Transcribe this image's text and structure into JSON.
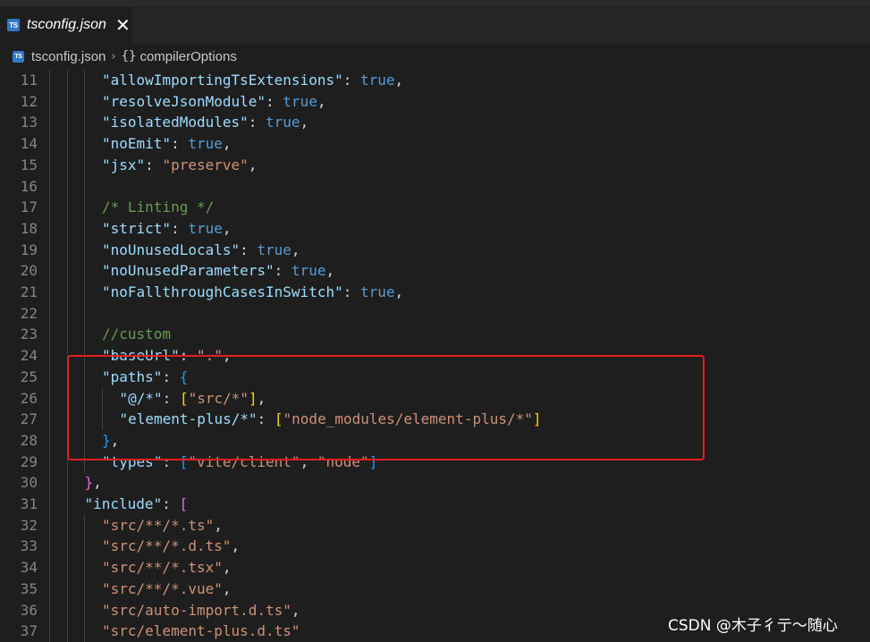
{
  "tab": {
    "icon": "TS",
    "title": "tsconfig.json",
    "close": "✕"
  },
  "breadcrumb": {
    "file": "tsconfig.json",
    "separator": "›",
    "symbol_icon": "{}",
    "symbol": "compilerOptions"
  },
  "lines": [
    {
      "n": "11",
      "indent": 8,
      "tokens": [
        [
          "k",
          "\"allowImportingTsExtensions\""
        ],
        [
          "p",
          ": "
        ],
        [
          "t",
          "true"
        ],
        [
          "p",
          ","
        ]
      ]
    },
    {
      "n": "12",
      "indent": 8,
      "tokens": [
        [
          "k",
          "\"resolveJsonModule\""
        ],
        [
          "p",
          ": "
        ],
        [
          "t",
          "true"
        ],
        [
          "p",
          ","
        ]
      ]
    },
    {
      "n": "13",
      "indent": 8,
      "tokens": [
        [
          "k",
          "\"isolatedModules\""
        ],
        [
          "p",
          ": "
        ],
        [
          "t",
          "true"
        ],
        [
          "p",
          ","
        ]
      ]
    },
    {
      "n": "14",
      "indent": 8,
      "tokens": [
        [
          "k",
          "\"noEmit\""
        ],
        [
          "p",
          ": "
        ],
        [
          "t",
          "true"
        ],
        [
          "p",
          ","
        ]
      ]
    },
    {
      "n": "15",
      "indent": 8,
      "tokens": [
        [
          "k",
          "\"jsx\""
        ],
        [
          "p",
          ": "
        ],
        [
          "s",
          "\"preserve\""
        ],
        [
          "p",
          ","
        ]
      ]
    },
    {
      "n": "16",
      "indent": 8,
      "tokens": []
    },
    {
      "n": "17",
      "indent": 8,
      "tokens": [
        [
          "c",
          "/* Linting */"
        ]
      ]
    },
    {
      "n": "18",
      "indent": 8,
      "tokens": [
        [
          "k",
          "\"strict\""
        ],
        [
          "p",
          ": "
        ],
        [
          "t",
          "true"
        ],
        [
          "p",
          ","
        ]
      ]
    },
    {
      "n": "19",
      "indent": 8,
      "tokens": [
        [
          "k",
          "\"noUnusedLocals\""
        ],
        [
          "p",
          ": "
        ],
        [
          "t",
          "true"
        ],
        [
          "p",
          ","
        ]
      ]
    },
    {
      "n": "20",
      "indent": 8,
      "tokens": [
        [
          "k",
          "\"noUnusedParameters\""
        ],
        [
          "p",
          ": "
        ],
        [
          "t",
          "true"
        ],
        [
          "p",
          ","
        ]
      ]
    },
    {
      "n": "21",
      "indent": 8,
      "tokens": [
        [
          "k",
          "\"noFallthroughCasesInSwitch\""
        ],
        [
          "p",
          ": "
        ],
        [
          "t",
          "true"
        ],
        [
          "p",
          ","
        ]
      ]
    },
    {
      "n": "22",
      "indent": 8,
      "tokens": []
    },
    {
      "n": "23",
      "indent": 8,
      "tokens": [
        [
          "c",
          "//custom"
        ]
      ]
    },
    {
      "n": "24",
      "indent": 8,
      "tokens": [
        [
          "k",
          "\"baseUrl\""
        ],
        [
          "p",
          ": "
        ],
        [
          "s",
          "\".\""
        ],
        [
          "p",
          ","
        ]
      ]
    },
    {
      "n": "25",
      "indent": 8,
      "tokens": [
        [
          "k",
          "\"paths\""
        ],
        [
          "p",
          ": "
        ],
        [
          "b2",
          "{"
        ]
      ]
    },
    {
      "n": "26",
      "indent": 10,
      "tokens": [
        [
          "k",
          "\"@/*\""
        ],
        [
          "p",
          ": "
        ],
        [
          "b3",
          "["
        ],
        [
          "s",
          "\"src/*\""
        ],
        [
          "b3",
          "]"
        ],
        [
          "p",
          ","
        ]
      ]
    },
    {
      "n": "27",
      "indent": 10,
      "tokens": [
        [
          "k",
          "\"element-plus/*\""
        ],
        [
          "p",
          ": "
        ],
        [
          "b3",
          "["
        ],
        [
          "s",
          "\"node_modules/element-plus/*\""
        ],
        [
          "b3",
          "]"
        ]
      ]
    },
    {
      "n": "28",
      "indent": 8,
      "tokens": [
        [
          "b2",
          "}"
        ],
        [
          "p",
          ","
        ]
      ]
    },
    {
      "n": "29",
      "indent": 8,
      "tokens": [
        [
          "k",
          "\"types\""
        ],
        [
          "p",
          ": "
        ],
        [
          "b2",
          "["
        ],
        [
          "s",
          "\"vite/client\""
        ],
        [
          "p",
          ", "
        ],
        [
          "s",
          "\"node\""
        ],
        [
          "b2",
          "]"
        ]
      ]
    },
    {
      "n": "30",
      "indent": 6,
      "tokens": [
        [
          "b1",
          "}"
        ],
        [
          "p",
          ","
        ]
      ]
    },
    {
      "n": "31",
      "indent": 6,
      "tokens": [
        [
          "k",
          "\"include\""
        ],
        [
          "p",
          ": "
        ],
        [
          "b1",
          "["
        ]
      ]
    },
    {
      "n": "32",
      "indent": 8,
      "tokens": [
        [
          "s",
          "\"src/**/*.ts\""
        ],
        [
          "p",
          ","
        ]
      ]
    },
    {
      "n": "33",
      "indent": 8,
      "tokens": [
        [
          "s",
          "\"src/**/*.d.ts\""
        ],
        [
          "p",
          ","
        ]
      ]
    },
    {
      "n": "34",
      "indent": 8,
      "tokens": [
        [
          "s",
          "\"src/**/*.tsx\""
        ],
        [
          "p",
          ","
        ]
      ]
    },
    {
      "n": "35",
      "indent": 8,
      "tokens": [
        [
          "s",
          "\"src/**/*.vue\""
        ],
        [
          "p",
          ","
        ]
      ]
    },
    {
      "n": "36",
      "indent": 8,
      "tokens": [
        [
          "s",
          "\"src/auto-import.d.ts\""
        ],
        [
          "p",
          ","
        ]
      ]
    },
    {
      "n": "37",
      "indent": 8,
      "tokens": [
        [
          "s",
          "\"src/element-plus.d.ts\""
        ]
      ]
    }
  ],
  "watermark": "CSDN @木子彳亍～随心",
  "colors": {
    "background": "#1e1e1e",
    "property": "#9cdcfe",
    "boolean": "#569cd6",
    "string": "#ce9178",
    "comment": "#6a9955",
    "highlight_box": "#e0201f"
  }
}
